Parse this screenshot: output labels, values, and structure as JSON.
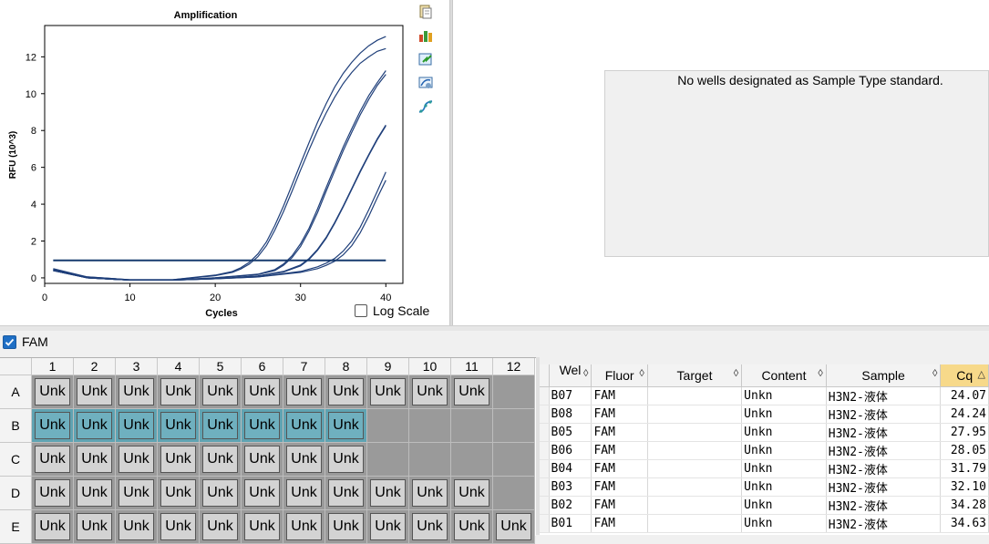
{
  "chart_data": {
    "type": "line",
    "title": "Amplification",
    "xlabel": "Cycles",
    "ylabel": "RFU (10^3)",
    "xlim": [
      0,
      42
    ],
    "ylim": [
      -0.3,
      13.7
    ],
    "xticks": [
      0,
      10,
      20,
      30,
      40
    ],
    "yticks": [
      0,
      2,
      4,
      6,
      8,
      10,
      12
    ],
    "grid": true,
    "threshold": 0.95,
    "series": [
      {
        "x": [
          1,
          5,
          10,
          15,
          20,
          22,
          23,
          24,
          25,
          26,
          27,
          28,
          29,
          30,
          31,
          32,
          33,
          34,
          35,
          36,
          37,
          38,
          39,
          40
        ],
        "y": [
          0.5,
          0.05,
          -0.1,
          -0.1,
          0.15,
          0.35,
          0.55,
          0.85,
          1.3,
          1.95,
          2.85,
          3.9,
          5.05,
          6.2,
          7.35,
          8.45,
          9.45,
          10.35,
          11.1,
          11.7,
          12.2,
          12.6,
          12.9,
          13.1
        ]
      },
      {
        "x": [
          1,
          5,
          10,
          15,
          20,
          22,
          23,
          24,
          25,
          26,
          27,
          28,
          29,
          30,
          31,
          32,
          33,
          34,
          35,
          36,
          37,
          38,
          39,
          40
        ],
        "y": [
          0.45,
          0.05,
          -0.1,
          -0.1,
          0.12,
          0.3,
          0.48,
          0.75,
          1.15,
          1.75,
          2.6,
          3.6,
          4.7,
          5.85,
          6.95,
          8.0,
          8.95,
          9.8,
          10.55,
          11.15,
          11.65,
          12.0,
          12.3,
          12.45
        ]
      },
      {
        "x": [
          1,
          5,
          10,
          15,
          20,
          25,
          27,
          28,
          29,
          30,
          31,
          32,
          33,
          34,
          35,
          36,
          37,
          38,
          39,
          40
        ],
        "y": [
          0.4,
          0.0,
          -0.12,
          -0.12,
          0.0,
          0.2,
          0.45,
          0.75,
          1.2,
          1.85,
          2.7,
          3.75,
          4.9,
          6.0,
          7.1,
          8.1,
          9.05,
          9.9,
          10.6,
          11.25
        ]
      },
      {
        "x": [
          1,
          5,
          10,
          15,
          20,
          25,
          27,
          28,
          29,
          30,
          31,
          32,
          33,
          34,
          35,
          36,
          37,
          38,
          39,
          40
        ],
        "y": [
          0.4,
          0.0,
          -0.12,
          -0.12,
          0.0,
          0.18,
          0.4,
          0.68,
          1.1,
          1.7,
          2.55,
          3.55,
          4.7,
          5.8,
          6.9,
          7.9,
          8.85,
          9.7,
          10.45,
          11.05
        ]
      },
      {
        "x": [
          1,
          5,
          10,
          15,
          20,
          25,
          28,
          30,
          31,
          32,
          33,
          34,
          35,
          36,
          37,
          38,
          39,
          40
        ],
        "y": [
          0.45,
          0.0,
          -0.12,
          -0.12,
          -0.05,
          0.1,
          0.35,
          0.7,
          1.05,
          1.55,
          2.2,
          3.0,
          3.9,
          4.85,
          5.8,
          6.7,
          7.55,
          8.3
        ]
      },
      {
        "x": [
          1,
          5,
          10,
          15,
          20,
          25,
          28,
          30,
          31,
          32,
          33,
          34,
          35,
          36,
          37,
          38,
          39,
          40
        ],
        "y": [
          0.4,
          0.0,
          -0.12,
          -0.12,
          -0.05,
          0.1,
          0.32,
          0.65,
          1.0,
          1.5,
          2.15,
          2.95,
          3.85,
          4.8,
          5.75,
          6.65,
          7.5,
          8.25
        ]
      },
      {
        "x": [
          1,
          5,
          10,
          15,
          20,
          25,
          30,
          32,
          33,
          34,
          35,
          36,
          37,
          38,
          39,
          40
        ],
        "y": [
          0.45,
          0.0,
          -0.12,
          -0.12,
          -0.05,
          0.05,
          0.35,
          0.6,
          0.8,
          1.05,
          1.45,
          2.0,
          2.75,
          3.7,
          4.7,
          5.75
        ]
      },
      {
        "x": [
          1,
          5,
          10,
          15,
          20,
          25,
          30,
          32,
          33,
          34,
          35,
          36,
          37,
          38,
          39,
          40
        ],
        "y": [
          0.4,
          0.0,
          -0.12,
          -0.12,
          -0.05,
          0.05,
          0.3,
          0.5,
          0.68,
          0.9,
          1.25,
          1.75,
          2.45,
          3.35,
          4.35,
          5.3
        ]
      }
    ]
  },
  "chart_panel": {
    "log_scale_label": "Log Scale",
    "log_scale_checked": false
  },
  "toolbar_icons": [
    "copy-icon",
    "export-icon",
    "export-graph-icon",
    "chart-settings-icon",
    "curve-fit-icon"
  ],
  "standard_curve": {
    "message": "No wells designated as Sample Type standard."
  },
  "fluor_filter": {
    "label": "FAM",
    "checked": true
  },
  "plate": {
    "columns": [
      "1",
      "2",
      "3",
      "4",
      "5",
      "6",
      "7",
      "8",
      "9",
      "10",
      "11",
      "12"
    ],
    "rows": [
      {
        "label": "A",
        "wells": [
          "Unk",
          "Unk",
          "Unk",
          "Unk",
          "Unk",
          "Unk",
          "Unk",
          "Unk",
          "Unk",
          "Unk",
          "Unk",
          ""
        ]
      },
      {
        "label": "B",
        "wells": [
          "Unk",
          "Unk",
          "Unk",
          "Unk",
          "Unk",
          "Unk",
          "Unk",
          "Unk",
          "",
          "",
          "",
          ""
        ],
        "selected_count": 8
      },
      {
        "label": "C",
        "wells": [
          "Unk",
          "Unk",
          "Unk",
          "Unk",
          "Unk",
          "Unk",
          "Unk",
          "Unk",
          "",
          "",
          "",
          ""
        ]
      },
      {
        "label": "D",
        "wells": [
          "Unk",
          "Unk",
          "Unk",
          "Unk",
          "Unk",
          "Unk",
          "Unk",
          "Unk",
          "Unk",
          "Unk",
          "Unk",
          ""
        ]
      },
      {
        "label": "E",
        "wells": [
          "Unk",
          "Unk",
          "Unk",
          "Unk",
          "Unk",
          "Unk",
          "Unk",
          "Unk",
          "Unk",
          "Unk",
          "Unk",
          "Unk"
        ]
      }
    ]
  },
  "results_table": {
    "headers": [
      {
        "label": "Wel",
        "sort": "◊"
      },
      {
        "label": "Fluor",
        "sort": "◊"
      },
      {
        "label": "Target",
        "sort": "◊"
      },
      {
        "label": "Content",
        "sort": "◊"
      },
      {
        "label": "Sample",
        "sort": "◊"
      },
      {
        "label": "Cq",
        "sort": "△"
      }
    ],
    "rows": [
      [
        "B07",
        "FAM",
        "",
        "Unkn",
        "H3N2-液体",
        "24.07"
      ],
      [
        "B08",
        "FAM",
        "",
        "Unkn",
        "H3N2-液体",
        "24.24"
      ],
      [
        "B05",
        "FAM",
        "",
        "Unkn",
        "H3N2-液体",
        "27.95"
      ],
      [
        "B06",
        "FAM",
        "",
        "Unkn",
        "H3N2-液体",
        "28.05"
      ],
      [
        "B04",
        "FAM",
        "",
        "Unkn",
        "H3N2-液体",
        "31.79"
      ],
      [
        "B03",
        "FAM",
        "",
        "Unkn",
        "H3N2-液体",
        "32.10"
      ],
      [
        "B02",
        "FAM",
        "",
        "Unkn",
        "H3N2-液体",
        "34.28"
      ],
      [
        "B01",
        "FAM",
        "",
        "Unkn",
        "H3N2-液体",
        "34.63"
      ]
    ]
  },
  "colors": {
    "curve": "#1f3f7a",
    "threshold": "#163a6e",
    "selected_well": "#6fb0bf",
    "well": "#d3d3d3",
    "empty_well": "#9a9a9a",
    "cq_header": "#f7d98a"
  }
}
